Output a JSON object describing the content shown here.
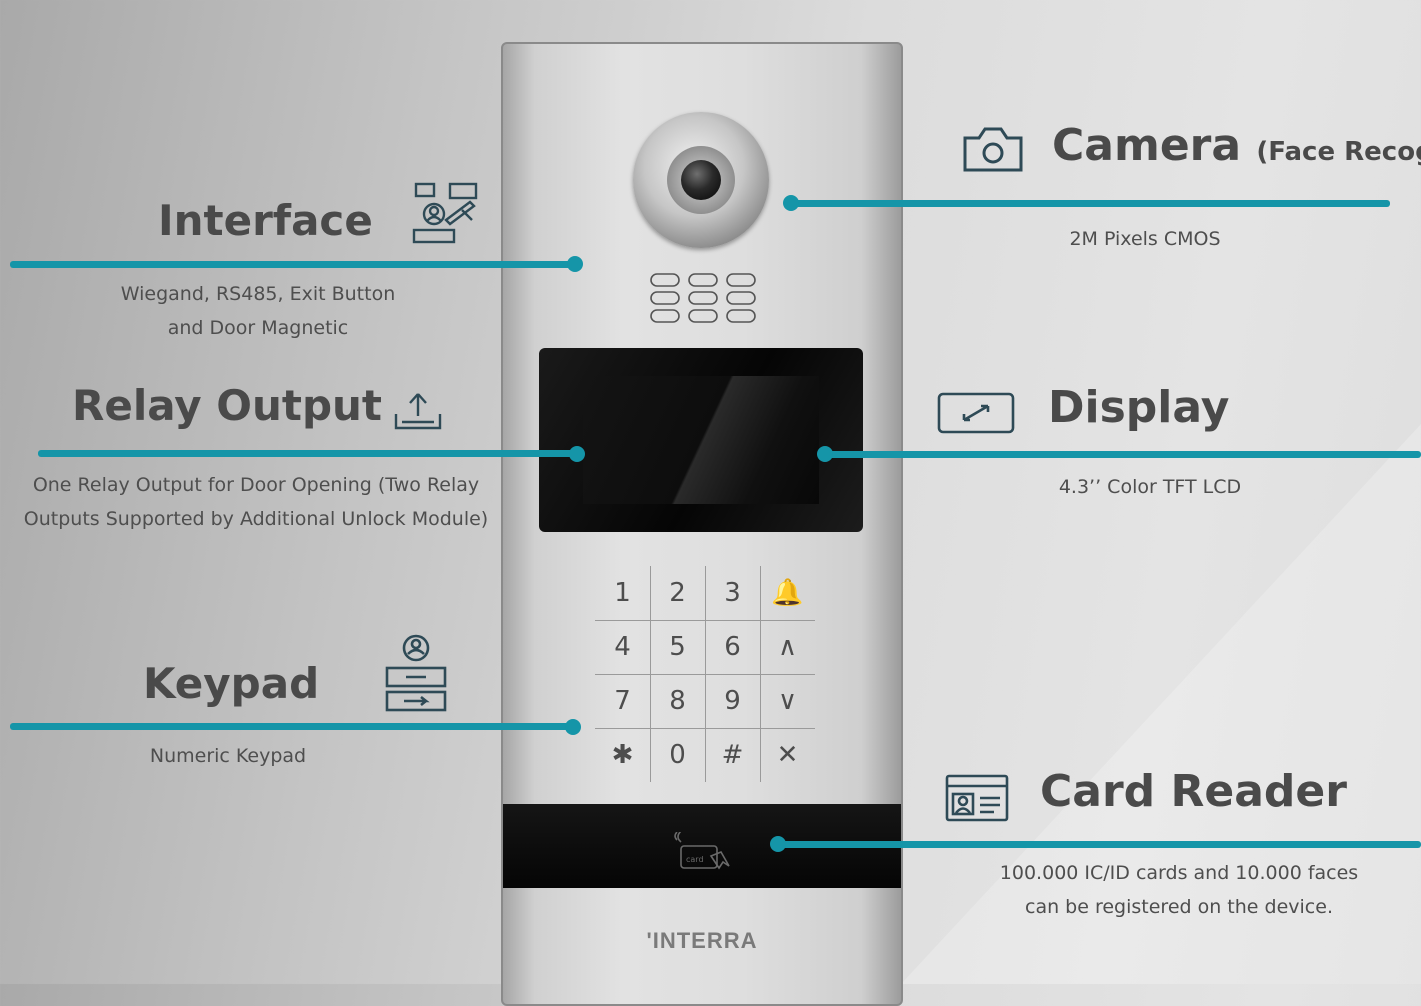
{
  "labels": {
    "interface": {
      "title": "Interface",
      "desc_line1": "Wiegand, RS485, Exit Button",
      "desc_line2": "and Door Magnetic",
      "icon": "interface-icon"
    },
    "relay": {
      "title": "Relay Output",
      "desc_line1": "One Relay Output for Door Opening (Two Relay",
      "desc_line2": "Outputs Supported by Additional Unlock Module)",
      "icon": "upload-tray-icon"
    },
    "keypad": {
      "title": "Keypad",
      "desc": "Numeric Keypad",
      "icon": "keypad-icon"
    },
    "camera": {
      "title": "Camera",
      "title_suffix": "(Face Recog",
      "desc": "2M Pixels CMOS",
      "icon": "camera-icon"
    },
    "display": {
      "title": "Display",
      "desc": "4.3’’ Color TFT LCD",
      "icon": "display-icon"
    },
    "card_reader": {
      "title": "Card Reader",
      "desc_line1": "100.000 IC/ID cards and 10.000 faces",
      "desc_line2": "can be registered on the device.",
      "icon": "id-card-icon"
    }
  },
  "device": {
    "brand": "'INTERRA",
    "card_label": "card",
    "keys": [
      "1",
      "2",
      "3",
      "🔔",
      "4",
      "5",
      "6",
      "∧",
      "7",
      "8",
      "9",
      "∨",
      "✱",
      "0",
      "#",
      "✕"
    ]
  },
  "colors": {
    "accent": "#1595a8",
    "text": "#4a4a4a",
    "icon": "#2e4a56"
  }
}
